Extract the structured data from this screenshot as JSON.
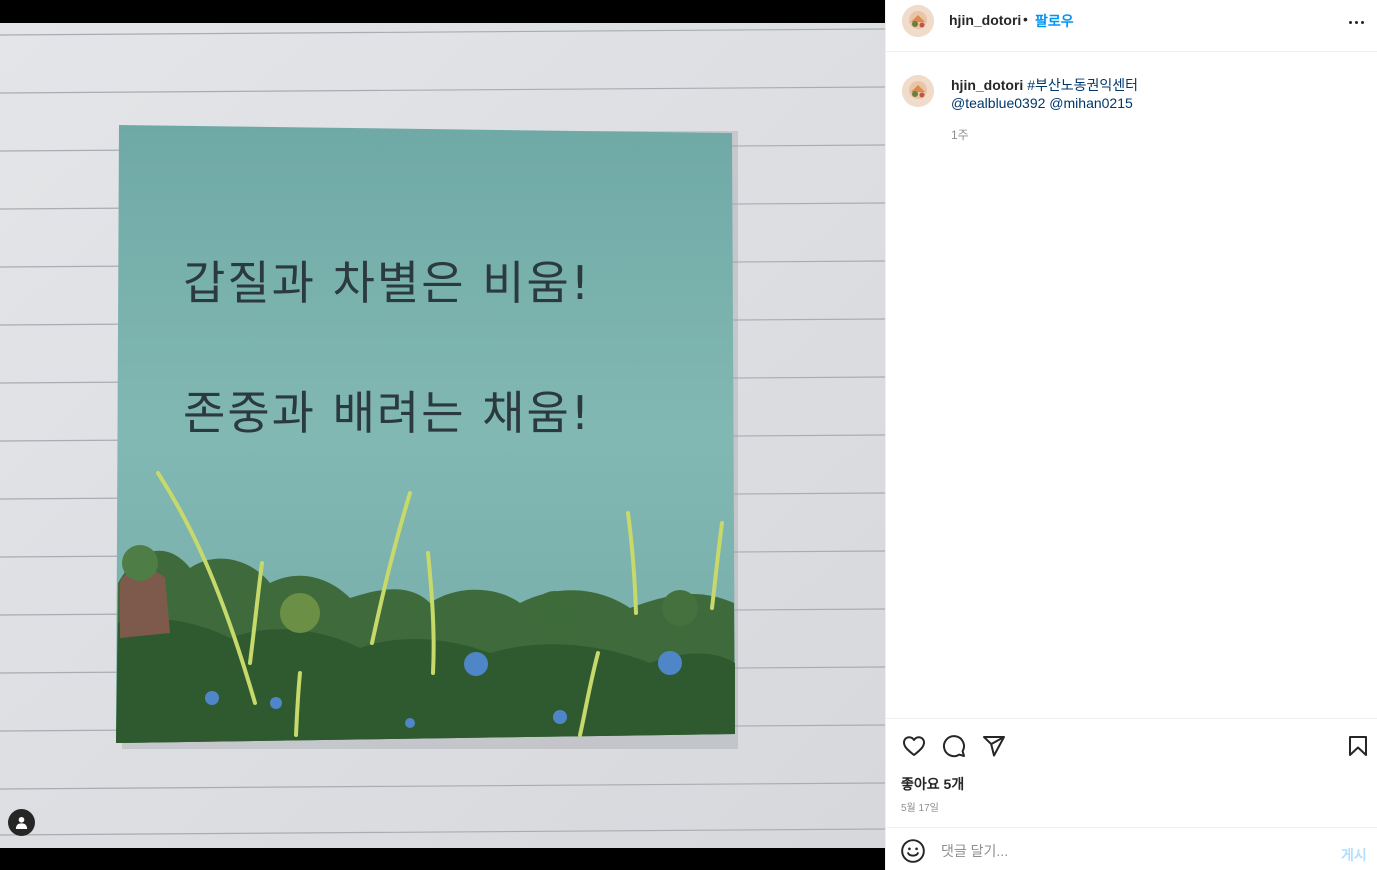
{
  "post": {
    "username": "hjin_dotori",
    "follow_label": "팔로우",
    "separator": "•"
  },
  "photo": {
    "note_line1": "갑질과 차별은 비움!",
    "note_line2": "존중과 배려는 채움!"
  },
  "caption": {
    "username": "hjin_dotori",
    "hashtag": "#부산노동권익센터",
    "mention1": "@tealblue0392",
    "mention2": "@mihan0215",
    "time_ago": "1주"
  },
  "engagement": {
    "likes": "좋아요 5개",
    "date": "5월 17일"
  },
  "comment": {
    "placeholder": "댓글 달기...",
    "post_label": "게시"
  },
  "icons": [
    "user-tag-icon",
    "more-icon",
    "heart-icon",
    "comment-icon",
    "share-icon",
    "bookmark-icon",
    "emoji-icon"
  ],
  "colors": {
    "link": "#0095f6",
    "hashtag": "#00376b",
    "note": "#7fb3ad"
  }
}
